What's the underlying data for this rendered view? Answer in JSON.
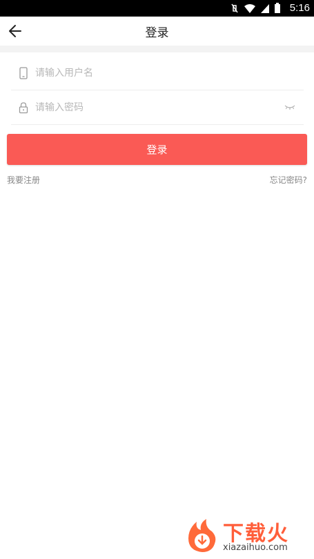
{
  "status_bar": {
    "time": "5:16"
  },
  "nav": {
    "title": "登录"
  },
  "form": {
    "username_placeholder": "请输入用户名",
    "password_placeholder": "请输入密码"
  },
  "actions": {
    "login_label": "登录",
    "register_label": "我要注册",
    "forgot_label": "忘记密码?"
  },
  "watermark": {
    "brand": "下载火",
    "site": "xiazaihuo.com"
  },
  "colors": {
    "accent": "#fa5a55",
    "placeholder": "#b8b8b8",
    "link": "#888888"
  }
}
